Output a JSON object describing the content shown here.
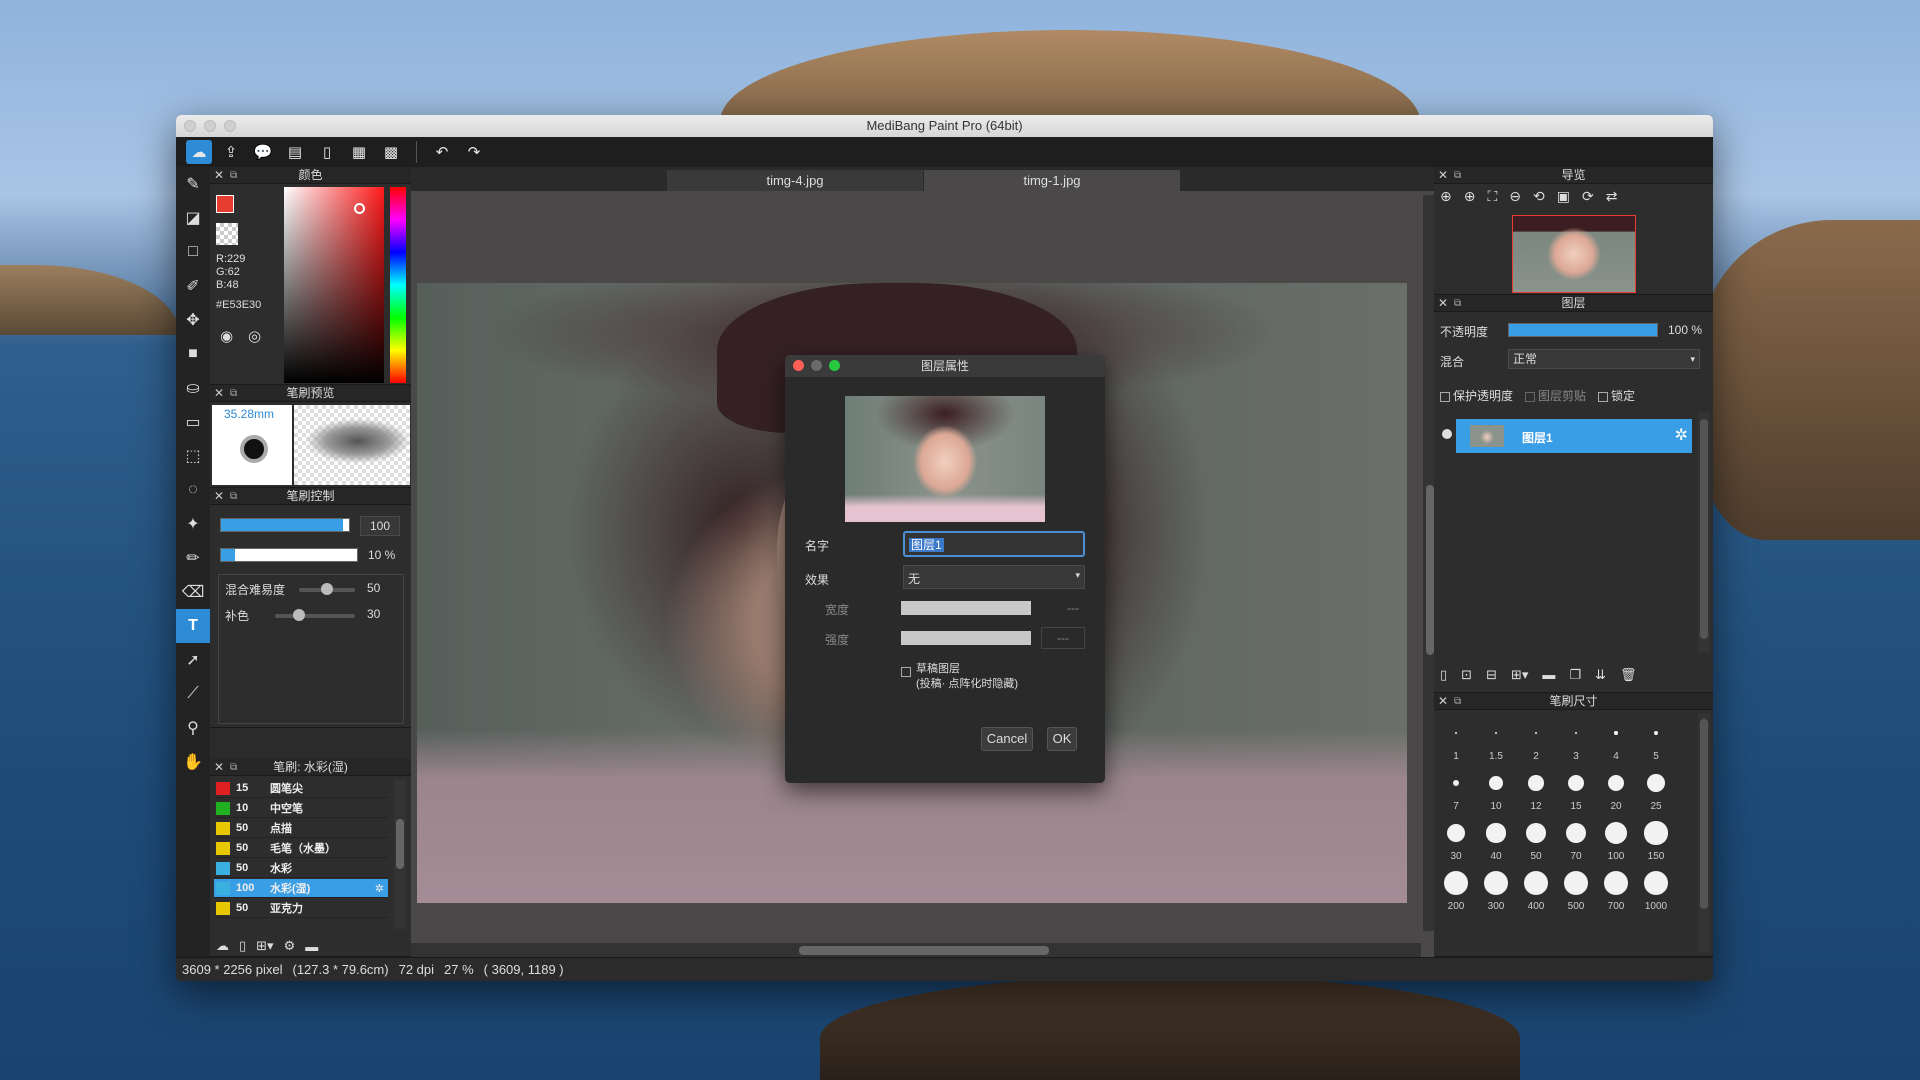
{
  "window": {
    "title": "MediBang Paint Pro (64bit)"
  },
  "toolbar": {
    "icons": [
      "cloud-icon",
      "share-icon",
      "speech-bubble-icon",
      "comic-icon",
      "page-icon",
      "grid-icon",
      "panel-icon",
      "undo-icon",
      "redo-icon"
    ]
  },
  "color_panel": {
    "title": "颜色",
    "r": "R:229",
    "g": "G:62",
    "b": "B:48",
    "hex": "#E53E30",
    "fg": "#E53E30"
  },
  "brush_preview": {
    "title": "笔刷预览",
    "size": "35.28mm"
  },
  "brush_control": {
    "title": "笔刷控制",
    "size_value": "100",
    "opacity_value": "10 %",
    "blend_label": "混合难易度",
    "blend_value": "50",
    "fill_label": "补色",
    "fill_value": "30",
    "size_level": 0.95,
    "opacity_level": 0.1,
    "blend_level": 0.5,
    "fill_level": 0.3
  },
  "brush_list": {
    "title": "笔刷: 水彩(湿)",
    "items": [
      {
        "size": "15",
        "name": "圆笔尖",
        "color": "#e02020"
      },
      {
        "size": "10",
        "name": "中空笔",
        "color": "#20b020"
      },
      {
        "size": "50",
        "name": "点描",
        "color": "#e8c800"
      },
      {
        "size": "50",
        "name": "毛笔（水墨）",
        "color": "#e8c800"
      },
      {
        "size": "50",
        "name": "水彩",
        "color": "#3ab0e0"
      },
      {
        "size": "100",
        "name": "水彩(湿)",
        "color": "#3ab0e0"
      },
      {
        "size": "50",
        "name": "亚克力",
        "color": "#e8c800"
      }
    ]
  },
  "tabs": [
    "timg-4.jpg",
    "timg-1.jpg"
  ],
  "status": {
    "size": "3609 * 2256 pixel",
    "cm": "(127.3 * 79.6cm)",
    "dpi": "72 dpi",
    "zoom": "27 %",
    "coord": "( 3609, 1189 )"
  },
  "navigator": {
    "title": "导览"
  },
  "layers": {
    "title": "图层",
    "opacity_label": "不透明度",
    "opacity_value": "100 %",
    "opacity_level": 1.0,
    "blend_label": "混合",
    "blend_value": "正常",
    "protect_label": "保护透明度",
    "clip_label": "图层剪贴",
    "lock_label": "锁定",
    "layer_name": "图层1"
  },
  "brush_size": {
    "title": "笔刷尺寸",
    "sizes": [
      "1",
      "1.5",
      "2",
      "3",
      "4",
      "5",
      "7",
      "10",
      "12",
      "15",
      "20",
      "25",
      "30",
      "40",
      "50",
      "70",
      "100",
      "150",
      "200",
      "300",
      "400",
      "500",
      "700",
      "1000"
    ]
  },
  "dialog": {
    "title": "图层属性",
    "name_label": "名字",
    "name_value": "图层1",
    "effect_label": "效果",
    "effect_value": "无",
    "width_label": "宽度",
    "width_value": "---",
    "strength_label": "强度",
    "strength_value": "---",
    "draft_label": "草稿图层",
    "draft_note": "(投稿· 点阵化时隐藏)",
    "cancel": "Cancel",
    "ok": "OK"
  }
}
